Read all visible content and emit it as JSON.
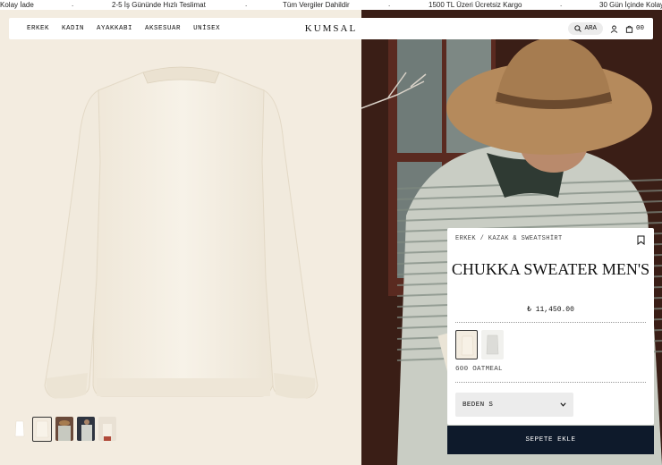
{
  "ticker": {
    "items": [
      "Kolay İade",
      "2-5 İş Gününde Hızlı Teslimat",
      "Tüm Vergiler Dahildir",
      "1500 TL Üzeri Ücretsiz Kargo",
      "30 Gün İçinde Kolay"
    ]
  },
  "header": {
    "nav": [
      "ERKEK",
      "KADIN",
      "AYAKKABI",
      "AKSESUAR",
      "UNİSEX"
    ],
    "brand": "KUMSAL",
    "search_label": "ARA",
    "cart_count": "00"
  },
  "gallery": {
    "thumbnail_count": 6,
    "active_index": 1
  },
  "product": {
    "breadcrumb": "ERKEK / KAZAK & SWEATSHİRT",
    "title": "CHUKKA SWEATER MEN'S",
    "price": "₺ 11,450.00",
    "color_name": "600 OATMEAL",
    "size_label": "BEDEN S",
    "add_to_cart": "SEPETE EKLE"
  },
  "colors": {
    "page_bg": "#f3ece0",
    "sweater": "#f5efe2",
    "button": "#0e1a2b",
    "photo_bg": "#3a1e16"
  },
  "icons": [
    "search-icon",
    "user-icon",
    "bag-icon",
    "bookmark-icon",
    "chevron-down-icon"
  ]
}
